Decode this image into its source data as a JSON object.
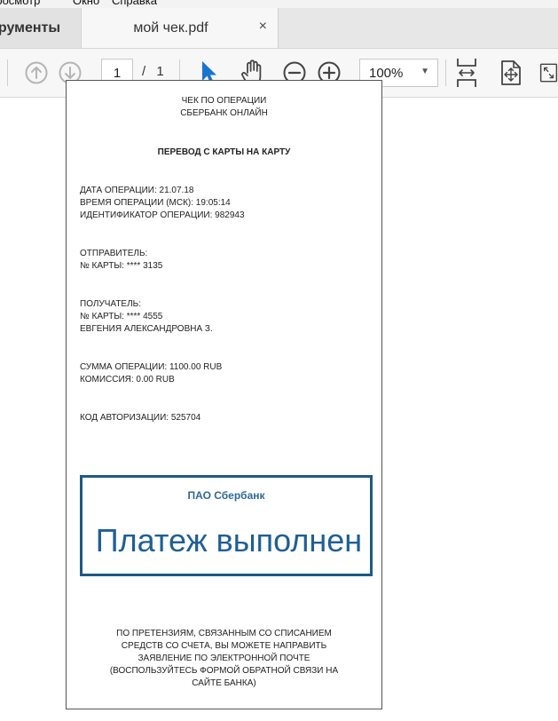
{
  "menubar": {
    "items": [
      "Просмотр",
      "Окно",
      "Справка"
    ]
  },
  "tabs": {
    "tools_label": "Инструменты",
    "document_title": "мой чек.pdf",
    "close_glyph": "×"
  },
  "toolbar": {
    "current_page": "1",
    "page_separator": "/",
    "total_pages": "1",
    "zoom": "100%",
    "zoom_caret": "▼"
  },
  "icons": {
    "prev_page": "arrow-up-circle-icon",
    "next_page": "arrow-down-circle-icon",
    "select_tool": "pointer-arrow-icon",
    "hand_tool": "hand-icon",
    "zoom_out": "zoom-out-icon",
    "zoom_in": "zoom-in-icon",
    "fit_width": "fit-width-icon",
    "fit_page": "fit-page-icon",
    "fullscreen": "fullscreen-icon"
  },
  "colors": {
    "accent_blue": "#1a74d0",
    "stamp_border": "#1d5a86",
    "stamp_text": "#1f5f94"
  },
  "receipt": {
    "header_line1": "ЧЕК ПО ОПЕРАЦИИ",
    "header_line2": "СБЕРБАНК ОНЛАЙН",
    "operation_type": "ПЕРЕВОД С КАРТЫ НА КАРТУ",
    "date_line": "ДАТА ОПЕРАЦИИ: 21.07.18",
    "time_line": "ВРЕМЯ ОПЕРАЦИИ (МСК): 19:05:14",
    "id_line": "ИДЕНТИФИКАТОР ОПЕРАЦИИ: 982943",
    "sender_label": "ОТПРАВИТЕЛЬ:",
    "sender_card": "№ КАРТЫ: **** 3135",
    "recipient_label": "ПОЛУЧАТЕЛЬ:",
    "recipient_card": "№ КАРТЫ: **** 4555",
    "recipient_name": "ЕВГЕНИЯ АЛЕКСАНДРОВНА З.",
    "amount_line": "СУММА ОПЕРАЦИИ: 1100.00 RUB",
    "fee_line": "КОМИССИЯ: 0.00 RUB",
    "auth_code_line": "КОД АВТОРИЗАЦИИ: 525704",
    "stamp_bank": "ПАО Сбербанк",
    "stamp_status": "Платеж выполнен",
    "footer_line1": "ПО ПРЕТЕНЗИЯМ, СВЯЗАННЫМ СО СПИСАНИЕМ",
    "footer_line2": "СРЕДСТВ СО СЧЕТА, ВЫ МОЖЕТЕ НАПРАВИТЬ",
    "footer_line3": "ЗАЯВЛЕНИЕ ПО ЭЛЕКТРОННОЙ ПОЧТЕ",
    "footer_line4": "(ВОСПОЛЬЗУЙТЕСЬ ФОРМОЙ ОБРАТНОЙ СВЯЗИ НА",
    "footer_line5": "САЙТЕ БАНКА)"
  }
}
